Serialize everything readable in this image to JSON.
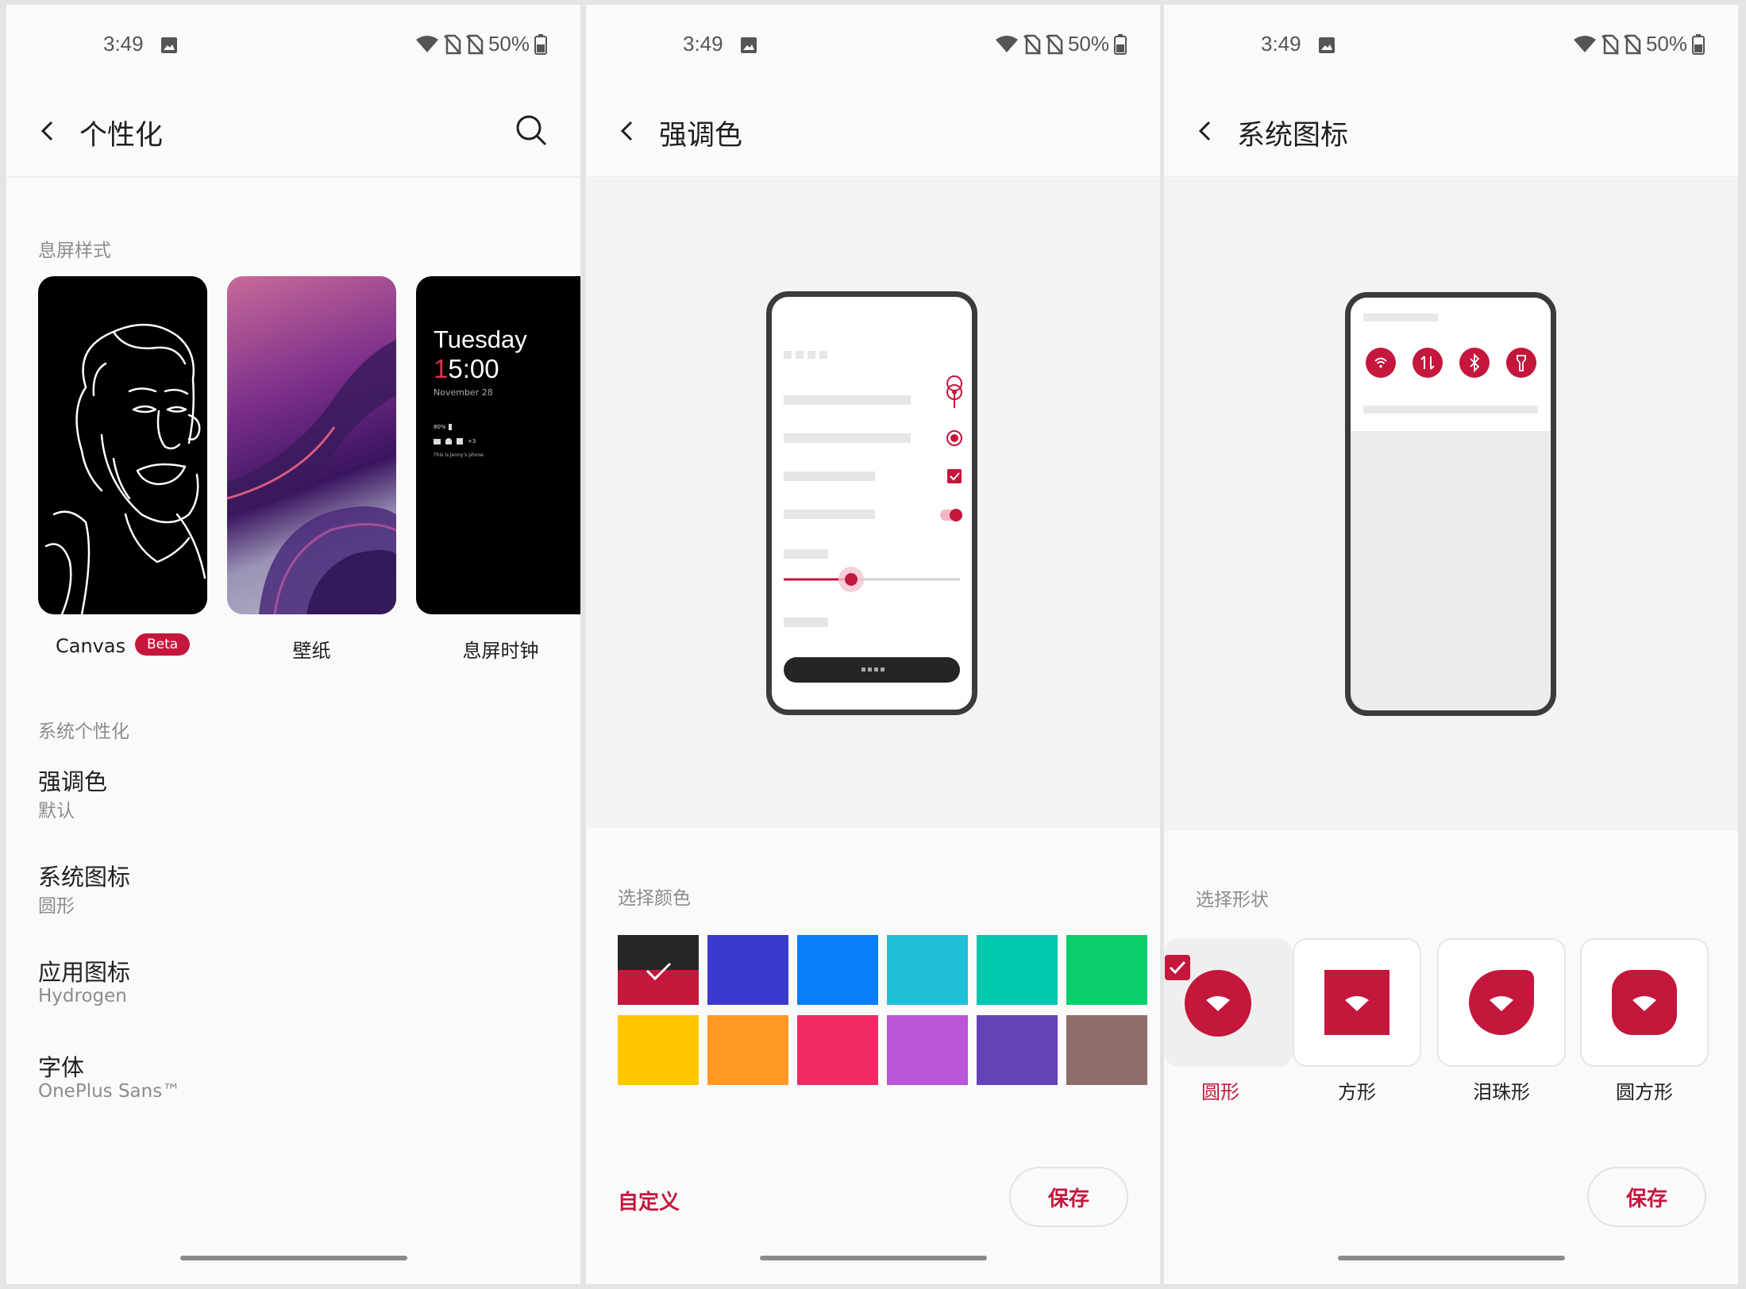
{
  "status": {
    "time": "3:49",
    "battery": "50%"
  },
  "accent_color": "#C5163C",
  "screen1": {
    "title": "个性化",
    "ambient_section": "息屏样式",
    "cards": [
      {
        "label": "Canvas",
        "badge": "Beta"
      },
      {
        "label": "壁纸"
      },
      {
        "label": "息屏时钟",
        "clock_day": "Tuesday",
        "clock_time_accent": "1",
        "clock_time_rest": "5:00",
        "clock_date": "November 28",
        "clock_battery": "80%",
        "clock_note": "This is Jenny's phone",
        "clock_more": "+3"
      }
    ],
    "system_section": "系统个性化",
    "items": [
      {
        "title": "强调色",
        "subtitle": "默认"
      },
      {
        "title": "系统图标",
        "subtitle": "圆形"
      },
      {
        "title": "应用图标",
        "subtitle": "Hydrogen"
      },
      {
        "title": "字体",
        "subtitle": "OnePlus Sans™"
      }
    ]
  },
  "screen2": {
    "title": "强调色",
    "section": "选择颜色",
    "colors": [
      "#C5163C",
      "#3A3ACC",
      "#0A7EF7",
      "#22BFD8",
      "#00C9B2",
      "#08CF6A",
      "#FFC700",
      "#FF9923",
      "#F02A65",
      "#B955D6",
      "#6642B8",
      "#8E6E68"
    ],
    "selected_color_index": 0,
    "custom_label": "自定义",
    "save_label": "保存"
  },
  "screen3": {
    "title": "系统图标",
    "section": "选择形状",
    "shapes": [
      {
        "label": "圆形",
        "selected": true
      },
      {
        "label": "方形",
        "selected": false
      },
      {
        "label": "泪珠形",
        "selected": false
      },
      {
        "label": "圆方形",
        "selected": false
      }
    ],
    "save_label": "保存"
  }
}
